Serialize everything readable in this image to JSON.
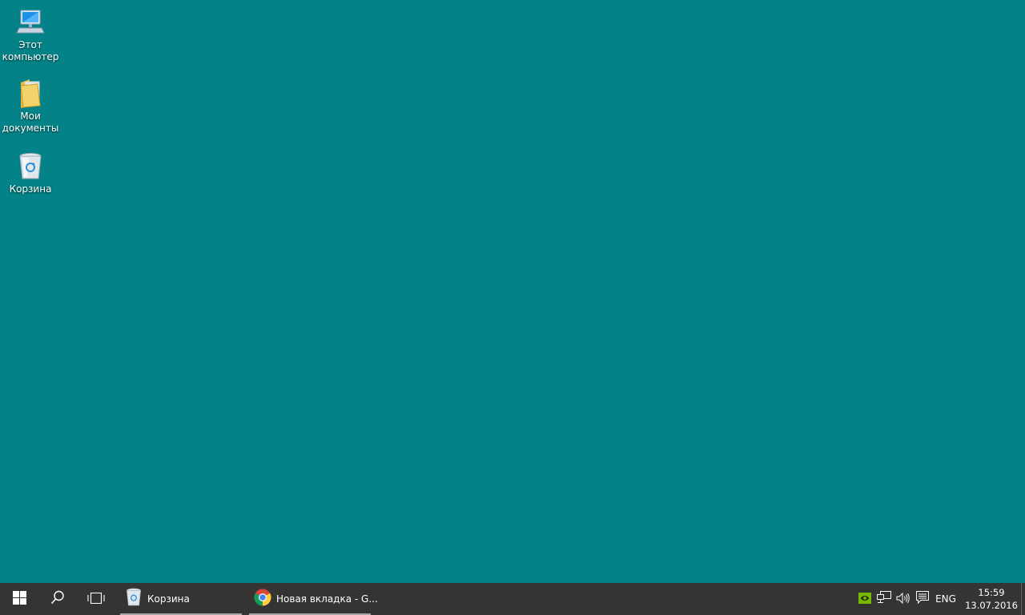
{
  "desktop": {
    "background_color": "#038387",
    "icons": [
      {
        "label": "Этот компьютер",
        "icon": "computer-icon"
      },
      {
        "label": "Мои документы",
        "icon": "folder-icon"
      },
      {
        "label": "Корзина",
        "icon": "recycle-bin-icon"
      }
    ]
  },
  "taskbar": {
    "background_color": "#353432",
    "start_icon": "windows-logo-icon",
    "search_icon": "search-icon",
    "task_view_icon": "task-view-icon",
    "apps": [
      {
        "label": "Корзина",
        "icon": "recycle-bin-icon"
      },
      {
        "label": "Новая вкладка - G...",
        "icon": "chrome-icon"
      }
    ],
    "tray": {
      "icons": [
        "nvidia-icon",
        "network-icon",
        "volume-icon",
        "action-center-icon"
      ],
      "language": "ENG"
    },
    "clock": {
      "time": "15:59",
      "date": "13.07.2016"
    }
  }
}
